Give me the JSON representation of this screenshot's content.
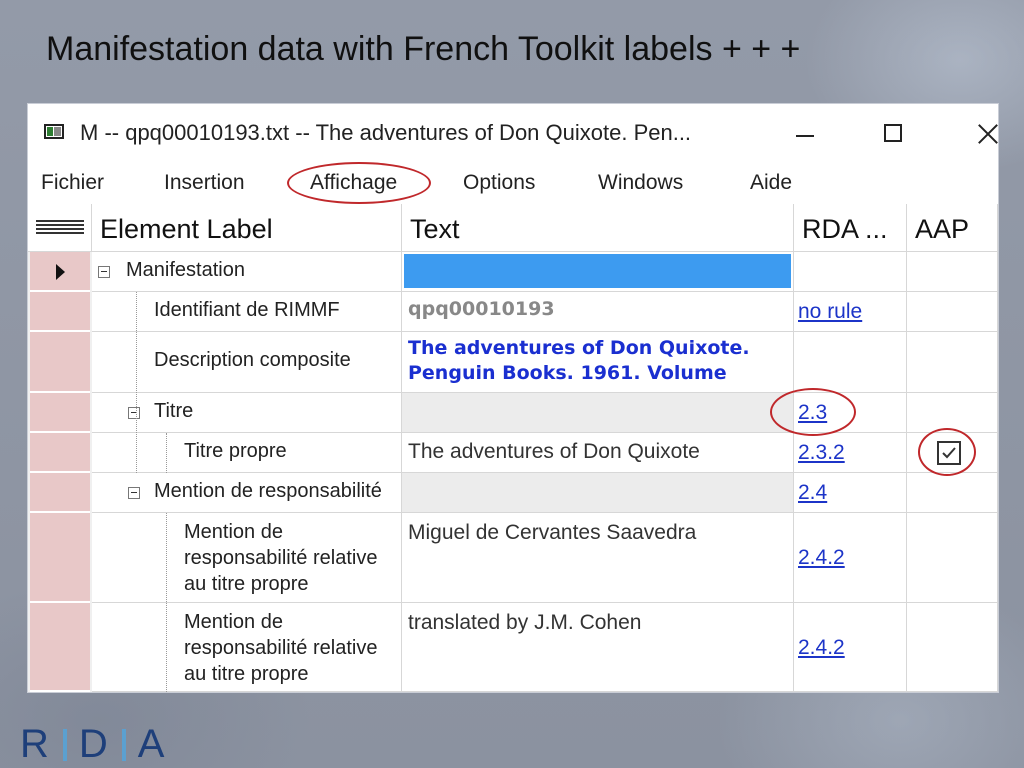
{
  "slide": {
    "title": "Manifestation data with French Toolkit labels + + +",
    "logo_letters": [
      "R",
      "D",
      "A"
    ]
  },
  "window": {
    "title": "M  --  qpq00010193.txt  --  The adventures of Don Quixote. Pen...",
    "menu": [
      "Fichier",
      "Insertion",
      "Affichage",
      "Options",
      "Windows",
      "Aide"
    ],
    "highlighted_menu": "Affichage"
  },
  "grid": {
    "headers": {
      "row_selector_icon": "lines-icon",
      "element_label": "Element Label",
      "text": "Text",
      "rda": "RDA ...",
      "aap": "AAP"
    },
    "rows": [
      {
        "label": "Manifestation",
        "text": "",
        "rda": "",
        "aap": false
      },
      {
        "label": "Identifiant de RIMMF",
        "text": "qpq00010193",
        "rda": "no rule",
        "aap": false
      },
      {
        "label": "Description composite",
        "text_line1": "The adventures of Don Quixote.",
        "text_line2": "Penguin Books. 1961. Volume",
        "rda": "",
        "aap": false
      },
      {
        "label": "Titre",
        "text": "",
        "rda": "2.3",
        "aap": false
      },
      {
        "label": "Titre propre",
        "text": "The adventures of Don Quixote",
        "rda": "2.3.2",
        "aap": true
      },
      {
        "label": "Mention de responsabilité",
        "text": "",
        "rda": "2.4",
        "aap": false
      },
      {
        "label_lines": [
          "Mention de",
          "responsabilité relative",
          "au titre propre"
        ],
        "text": "Miguel de Cervantes Saavedra",
        "rda": "2.4.2",
        "aap": false
      },
      {
        "label_lines": [
          "Mention de",
          "responsabilité relative",
          "au titre propre"
        ],
        "text": "translated by J.M. Cohen",
        "rda": "2.4.2",
        "aap": false
      }
    ]
  },
  "colors": {
    "selected_cell": "#3d9bf0",
    "link": "#1c34c8",
    "composite_text": "#1a2fd0",
    "highlight_ring": "#c0282b",
    "row_header": "#e8c8c8"
  }
}
